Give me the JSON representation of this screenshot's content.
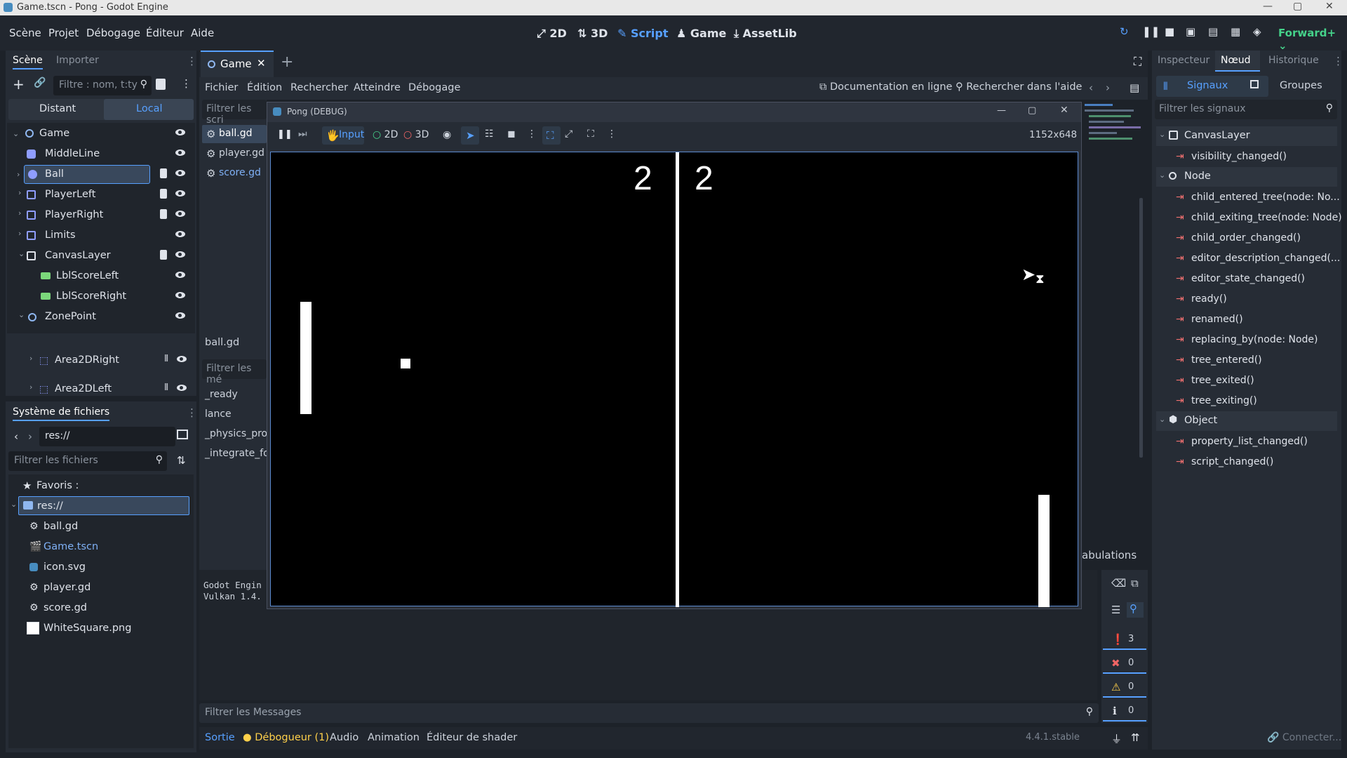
{
  "window": {
    "title": "Game.tscn - Pong - Godot Engine"
  },
  "menu": [
    "Scène",
    "Projet",
    "Débogage",
    "Éditeur",
    "Aide"
  ],
  "workspaces": {
    "w2d": "2D",
    "w3d": "3D",
    "script": "Script",
    "game": "Game",
    "assetlib": "AssetLib"
  },
  "renderer": "Forward+",
  "scene_panel": {
    "tabs": [
      "Scène",
      "Importer"
    ],
    "filter_placeholder": "Filtre : nom, t:ty",
    "remote_tab": "Distant",
    "local_tab": "Local",
    "nodes": [
      {
        "name": "Game"
      },
      {
        "name": "MiddleLine"
      },
      {
        "name": "Ball"
      },
      {
        "name": "PlayerLeft"
      },
      {
        "name": "PlayerRight"
      },
      {
        "name": "Limits"
      },
      {
        "name": "CanvasLayer"
      },
      {
        "name": "LblScoreLeft"
      },
      {
        "name": "LblScoreRight"
      },
      {
        "name": "ZonePoint"
      },
      {
        "name": "Area2DLeft"
      },
      {
        "name": "Area2DRight"
      }
    ]
  },
  "filesystem": {
    "title": "Système de fichiers",
    "path": "res://",
    "filter_placeholder": "Filtrer les fichiers",
    "favorites": "Favoris :",
    "root": "res://",
    "files": [
      "ball.gd",
      "Game.tscn",
      "icon.svg",
      "player.gd",
      "score.gd",
      "WhiteSquare.png"
    ]
  },
  "script_editor": {
    "tab_label": "Game",
    "menu": [
      "Fichier",
      "Édition",
      "Rechercher",
      "Atteindre",
      "Débogage"
    ],
    "online_docs": "Documentation en ligne",
    "search_help": "Rechercher dans l'aide",
    "filter_scripts": "Filtrer les scri",
    "scripts": [
      "ball.gd",
      "player.gd",
      "score.gd"
    ],
    "current_script": "ball.gd",
    "filter_methods": "Filtrer les mé",
    "methods": [
      "_ready",
      "lance",
      "_physics_pro",
      "_integrate_fo"
    ],
    "tabs_hint": "abulations"
  },
  "output": {
    "lines": [
      "Godot Engin",
      "Vulkan 1.4."
    ],
    "filter_placeholder": "Filtrer les Messages",
    "counts": {
      "all": "3",
      "errors": "0",
      "warnings": "0",
      "info": "0"
    }
  },
  "bottom_tabs": [
    "Sortie",
    "Débogueur (1)",
    "Audio",
    "Animation",
    "Éditeur de shader"
  ],
  "version": "4.4.1.stable",
  "inspector": {
    "tabs": [
      "Inspecteur",
      "Nœud",
      "Historique"
    ],
    "signals_tab": "Signaux",
    "groups_tab": "Groupes",
    "filter_placeholder": "Filtrer les signaux",
    "sections": [
      {
        "name": "CanvasLayer",
        "signals": [
          "visibility_changed()"
        ]
      },
      {
        "name": "Node",
        "signals": [
          "child_entered_tree(node: No...",
          "child_exiting_tree(node: Node)",
          "child_order_changed()",
          "editor_description_changed(...",
          "editor_state_changed()",
          "ready()",
          "renamed()",
          "replacing_by(node: Node)",
          "tree_entered()",
          "tree_exited()",
          "tree_exiting()"
        ]
      },
      {
        "name": "Object",
        "signals": [
          "property_list_changed()",
          "script_changed()"
        ]
      }
    ],
    "connect": "Connecter..."
  },
  "game_window": {
    "title": "Pong (DEBUG)",
    "toolbar": {
      "input": "Input",
      "t2d": "2D",
      "t3d": "3D"
    },
    "resolution": "1152x648",
    "score_left": "2",
    "score_right": "2"
  },
  "colors": {
    "accent": "#57a0ff",
    "bg": "#1d2229",
    "panel": "#262c35"
  }
}
